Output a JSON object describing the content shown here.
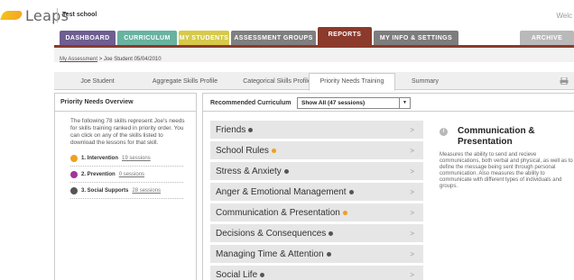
{
  "app": {
    "logo_text": "Leaps",
    "school": "Test school",
    "welcome": "Welc"
  },
  "nav": {
    "tabs": [
      {
        "label": "DASHBOARD",
        "color": "#6e5e91"
      },
      {
        "label": "CURRICULUM",
        "color": "#68b2a0"
      },
      {
        "label": "MY STUDENTS",
        "color": "#d6c94a"
      },
      {
        "label": "ASSESSMENT GROUPS",
        "color": "#7f7f7f"
      },
      {
        "label": "REPORTS",
        "color": "#8b3a2c"
      },
      {
        "label": "MY INFO & SETTINGS",
        "color": "#7d7d7d"
      },
      {
        "label": "ARCHIVE",
        "color": "#b9b9b9"
      }
    ]
  },
  "breadcrumb": {
    "link": "My Assessment",
    "separator": ">",
    "current": "Joe Student 05/04/2010"
  },
  "subtabs": [
    {
      "label": "Joe Student"
    },
    {
      "label": "Aggregate Skills Profile"
    },
    {
      "label": "Categorical Skills Profile"
    },
    {
      "label": "Priority Needs Training"
    },
    {
      "label": "Summary"
    }
  ],
  "overview": {
    "title": "Priority Needs Overview",
    "text": "The following 78 skills represent Joe's needs for skills training ranked in priority order. You can click on any of the skills listed to download the lessons for that skill.",
    "legend": [
      {
        "label": "1. Intervention",
        "link": "19 sessions",
        "color": "#f0a020"
      },
      {
        "label": "2. Prevention",
        "link": "0 sessions",
        "color": "#a0349a"
      },
      {
        "label": "3. Social Supports",
        "link": "28 sessions",
        "color": "#555555"
      }
    ]
  },
  "curriculum": {
    "label": "Recommended Curriculum",
    "select_value": "Show All (47 sessions)",
    "select_arrow": "▼",
    "items": [
      {
        "label": "Friends",
        "color": "#555555"
      },
      {
        "label": "School Rules",
        "color": "#f0a020"
      },
      {
        "label": "Stress & Anxiety",
        "color": "#555555"
      },
      {
        "label": "Anger & Emotional Management",
        "color": "#555555"
      },
      {
        "label": "Communication & Presentation",
        "color": "#f0a020"
      },
      {
        "label": "Decisions & Consequences",
        "color": "#555555"
      },
      {
        "label": "Managing Time & Attention",
        "color": "#555555"
      },
      {
        "label": "Social Life",
        "color": "#555555"
      }
    ],
    "chevron": ">"
  },
  "detail": {
    "icon": "i",
    "title": "Communication & Presentation",
    "text": "Measures the ability to send and recieve communications, both verbal and physical, as well as to define the message being sent through personal communication. Also measures the ability to communicate with different types of individuals and groups."
  }
}
